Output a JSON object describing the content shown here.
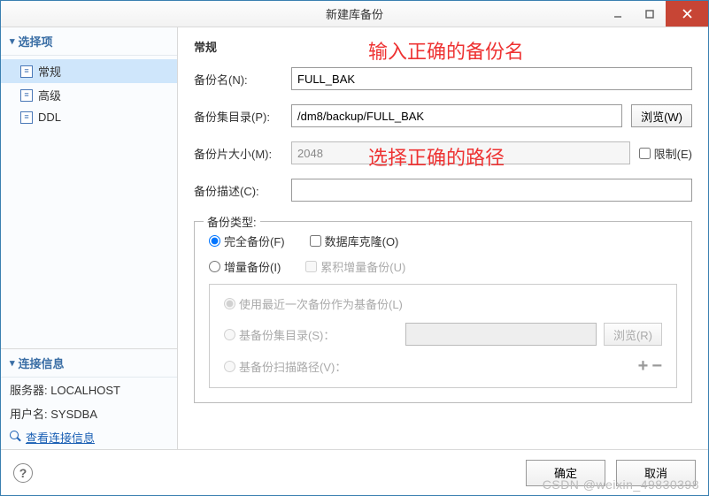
{
  "window": {
    "title": "新建库备份"
  },
  "sidebar": {
    "sections": {
      "options": "选择项",
      "conn": "连接信息"
    },
    "nav": [
      {
        "label": "常规",
        "selected": true
      },
      {
        "label": "高级",
        "selected": false
      },
      {
        "label": "DDL",
        "selected": false
      }
    ],
    "conn": {
      "server_label": "服务器:",
      "server_value": "LOCALHOST",
      "user_label": "用户名:",
      "user_value": "SYSDBA",
      "link": "查看连接信息"
    }
  },
  "main": {
    "header": "常规",
    "backup_name": {
      "label": "备份名(N):",
      "value": "FULL_BAK"
    },
    "backup_dir": {
      "label": "备份集目录(P):",
      "value": "/dm8/backup/FULL_BAK",
      "browse": "浏览(W)"
    },
    "piece_size": {
      "label": "备份片大小(M):",
      "value": "2048",
      "limit_label": "限制(E)"
    },
    "desc": {
      "label": "备份描述(C):",
      "value": ""
    },
    "group_title": "备份类型:",
    "radios": {
      "full": "完全备份(F)",
      "inc": "增量备份(I)",
      "clone_label": "数据库克隆(O)",
      "cum_label": "累积增量备份(U)"
    },
    "inner": {
      "use_last": "使用最近一次备份作为基备份(L)",
      "base_dir_label": "基备份集目录(S)：",
      "base_dir_value": "",
      "base_dir_browse": "浏览(R)",
      "scan_path_label": "基备份扫描路径(V)："
    }
  },
  "footer": {
    "ok": "确定",
    "cancel": "取消"
  },
  "annotations": {
    "a1": "输入正确的备份名",
    "a2": "选择正确的路径"
  },
  "watermark": "CSDN @weixin_49830398"
}
